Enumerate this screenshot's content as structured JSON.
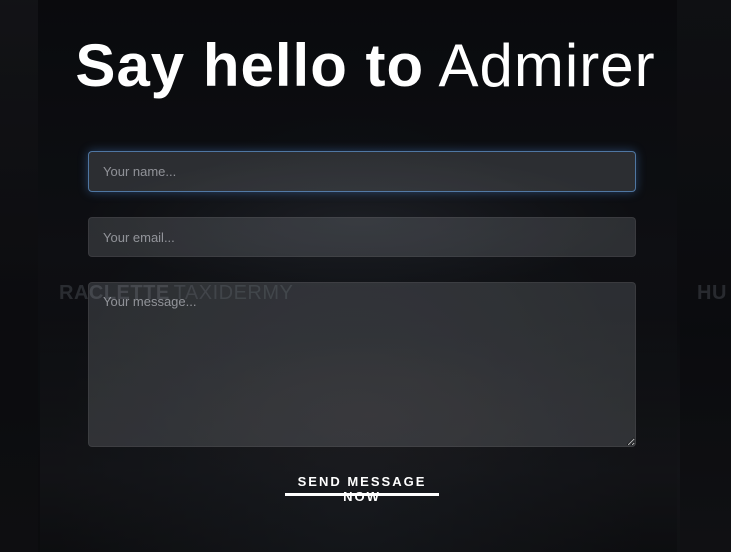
{
  "title": {
    "bold": "Say hello to",
    "thin": "Admirer"
  },
  "form": {
    "name_placeholder": "Your name...",
    "email_placeholder": "Your email...",
    "message_placeholder": "Your message...",
    "submit_label": "SEND MESSAGE NOW"
  },
  "background": {
    "left_label_bold": "RACLETTE",
    "left_label_light": "TAXIDERMY",
    "right_label_bold": "HU"
  },
  "colors": {
    "text": "#ffffff",
    "focus_glow": "#5aa0ff",
    "field_bg": "rgba(210,215,225,0.16)"
  }
}
